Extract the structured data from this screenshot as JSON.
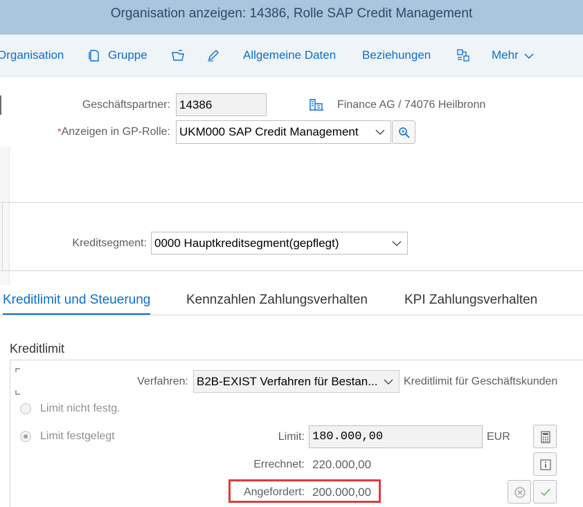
{
  "window": {
    "title": "Organisation anzeigen: 14386, Rolle SAP Credit Management"
  },
  "toolbar": {
    "organisation_label": "Organisation",
    "gruppe_label": "Gruppe",
    "allgemeine_daten_label": "Allgemeine Daten",
    "beziehungen_label": "Beziehungen",
    "mehr_label": "Mehr"
  },
  "header": {
    "gp_label": "Geschäftspartner:",
    "gp_value": "14386",
    "gp_description": "Finance AG / 74076 Heilbronn",
    "required_mark": "*",
    "role_label": "Anzeigen in GP-Rolle:",
    "role_value": "UKM000 SAP Credit Management"
  },
  "segment": {
    "label": "Kreditsegment:",
    "value": "0000 Hauptkreditsegment(gepflegt)"
  },
  "tabs": [
    {
      "label": "Kreditlimit und Steuerung",
      "active": true
    },
    {
      "label": "Kennzahlen Zahlungsverhalten",
      "active": false
    },
    {
      "label": "KPI Zahlungsverhalten",
      "active": false
    }
  ],
  "kreditlimit": {
    "section_title": "Kreditlimit",
    "verfahren_label": "Verfahren:",
    "verfahren_value": "B2B-EXIST Verfahren für Bestan...",
    "verfahren_description": "Kreditlimit für Geschäftskunden",
    "radio_not_fixed": "Limit nicht festg.",
    "radio_fixed": "Limit  festgelegt",
    "selected_radio": "radio_fixed",
    "limit_label": "Limit:",
    "limit_value": "180.000,00",
    "currency": "EUR",
    "errechnet_label": "Errechnet:",
    "errechnet_value": "220.000,00",
    "angefordert_label": "Angefordert:",
    "angefordert_value": "200.000,00"
  },
  "colors": {
    "title_bar": "#a9c6de",
    "toolbar": "#eff4f9",
    "link_blue": "#0a6ed1",
    "highlight_red": "#e03a3a",
    "accept_green": "#2b7d2b"
  }
}
